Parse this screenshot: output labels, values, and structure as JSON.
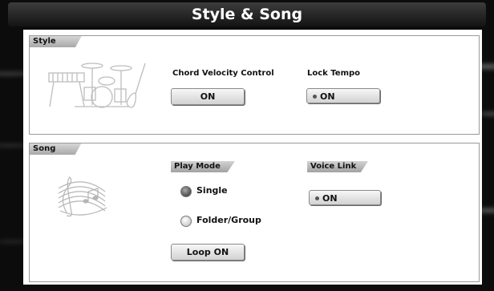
{
  "window": {
    "title": "Style & Song"
  },
  "style_panel": {
    "tab_label": "Style",
    "illustration_icon": "band-instruments-icon",
    "chord_velocity": {
      "label": "Chord Velocity Control",
      "button": "ON"
    },
    "lock_tempo": {
      "label": "Lock Tempo",
      "button": "ON"
    }
  },
  "song_panel": {
    "tab_label": "Song",
    "illustration_icon": "music-staff-icon",
    "play_mode": {
      "label": "Play Mode",
      "options": [
        {
          "label": "Single",
          "selected": true
        },
        {
          "label": "Folder/Group",
          "selected": false
        }
      ],
      "loop_button": "Loop ON"
    },
    "voice_link": {
      "label": "Voice Link",
      "button": "ON"
    }
  }
}
